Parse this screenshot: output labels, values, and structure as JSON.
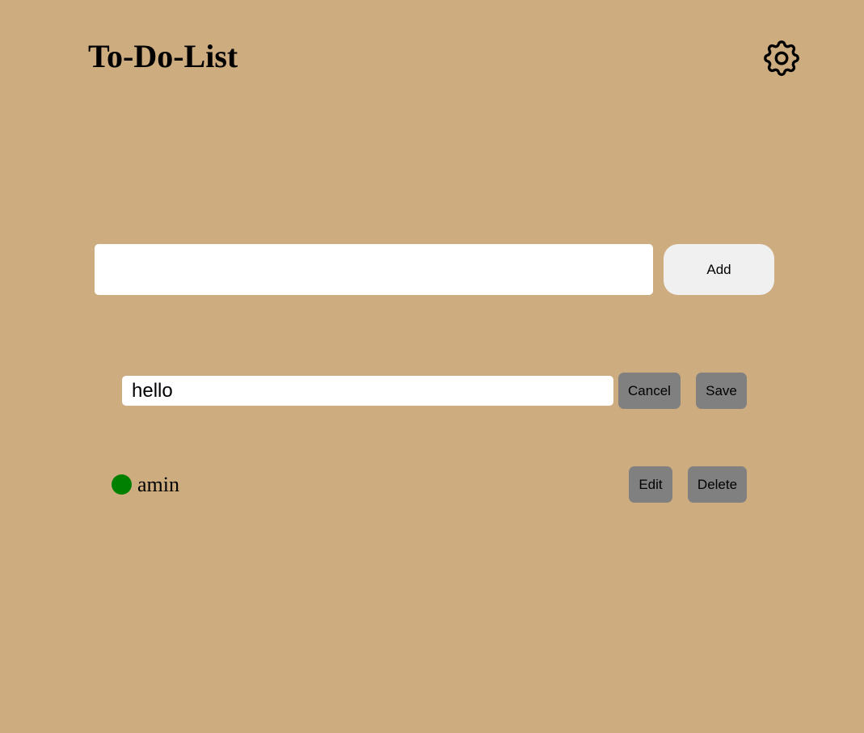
{
  "header": {
    "title": "To-Do-List",
    "settings_icon": "gear-icon"
  },
  "new_task": {
    "value": "",
    "placeholder": "",
    "add_label": "Add"
  },
  "editing_task": {
    "value": "hello",
    "cancel_label": "Cancel",
    "save_label": "Save"
  },
  "tasks": [
    {
      "text": "amin",
      "status_color": "#008000",
      "edit_label": "Edit",
      "delete_label": "Delete"
    }
  ],
  "colors": {
    "background": "#CDAC80",
    "button_gray": "#808080",
    "add_button": "#F0F0F0",
    "status_green": "#008000"
  }
}
